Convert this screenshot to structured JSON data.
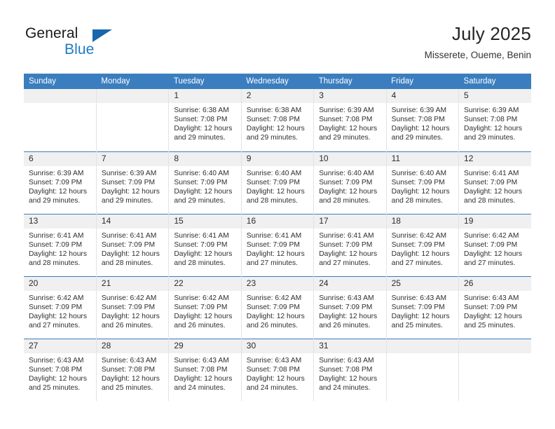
{
  "brand": {
    "name_part1": "General",
    "name_part2": "Blue",
    "logo_icon": "triangle-logo-icon"
  },
  "header": {
    "title": "July 2025",
    "subtitle": "Misserete, Oueme, Benin"
  },
  "weekday_headers": [
    "Sunday",
    "Monday",
    "Tuesday",
    "Wednesday",
    "Thursday",
    "Friday",
    "Saturday"
  ],
  "colors": {
    "header_blue": "#3b7ebf",
    "brand_blue": "#1e7bc4",
    "logo_blue": "#1767ab",
    "daynum_bg": "#f0f0f0",
    "grid_line": "#e3e3e3"
  },
  "weeks": [
    [
      {
        "day": "",
        "empty": true,
        "lines": []
      },
      {
        "day": "",
        "empty": true,
        "lines": []
      },
      {
        "day": "1",
        "empty": false,
        "lines": [
          "Sunrise: 6:38 AM",
          "Sunset: 7:08 PM",
          "Daylight: 12 hours",
          "and 29 minutes."
        ]
      },
      {
        "day": "2",
        "empty": false,
        "lines": [
          "Sunrise: 6:38 AM",
          "Sunset: 7:08 PM",
          "Daylight: 12 hours",
          "and 29 minutes."
        ]
      },
      {
        "day": "3",
        "empty": false,
        "lines": [
          "Sunrise: 6:39 AM",
          "Sunset: 7:08 PM",
          "Daylight: 12 hours",
          "and 29 minutes."
        ]
      },
      {
        "day": "4",
        "empty": false,
        "lines": [
          "Sunrise: 6:39 AM",
          "Sunset: 7:08 PM",
          "Daylight: 12 hours",
          "and 29 minutes."
        ]
      },
      {
        "day": "5",
        "empty": false,
        "lines": [
          "Sunrise: 6:39 AM",
          "Sunset: 7:08 PM",
          "Daylight: 12 hours",
          "and 29 minutes."
        ]
      }
    ],
    [
      {
        "day": "6",
        "empty": false,
        "lines": [
          "Sunrise: 6:39 AM",
          "Sunset: 7:09 PM",
          "Daylight: 12 hours",
          "and 29 minutes."
        ]
      },
      {
        "day": "7",
        "empty": false,
        "lines": [
          "Sunrise: 6:39 AM",
          "Sunset: 7:09 PM",
          "Daylight: 12 hours",
          "and 29 minutes."
        ]
      },
      {
        "day": "8",
        "empty": false,
        "lines": [
          "Sunrise: 6:40 AM",
          "Sunset: 7:09 PM",
          "Daylight: 12 hours",
          "and 29 minutes."
        ]
      },
      {
        "day": "9",
        "empty": false,
        "lines": [
          "Sunrise: 6:40 AM",
          "Sunset: 7:09 PM",
          "Daylight: 12 hours",
          "and 28 minutes."
        ]
      },
      {
        "day": "10",
        "empty": false,
        "lines": [
          "Sunrise: 6:40 AM",
          "Sunset: 7:09 PM",
          "Daylight: 12 hours",
          "and 28 minutes."
        ]
      },
      {
        "day": "11",
        "empty": false,
        "lines": [
          "Sunrise: 6:40 AM",
          "Sunset: 7:09 PM",
          "Daylight: 12 hours",
          "and 28 minutes."
        ]
      },
      {
        "day": "12",
        "empty": false,
        "lines": [
          "Sunrise: 6:41 AM",
          "Sunset: 7:09 PM",
          "Daylight: 12 hours",
          "and 28 minutes."
        ]
      }
    ],
    [
      {
        "day": "13",
        "empty": false,
        "lines": [
          "Sunrise: 6:41 AM",
          "Sunset: 7:09 PM",
          "Daylight: 12 hours",
          "and 28 minutes."
        ]
      },
      {
        "day": "14",
        "empty": false,
        "lines": [
          "Sunrise: 6:41 AM",
          "Sunset: 7:09 PM",
          "Daylight: 12 hours",
          "and 28 minutes."
        ]
      },
      {
        "day": "15",
        "empty": false,
        "lines": [
          "Sunrise: 6:41 AM",
          "Sunset: 7:09 PM",
          "Daylight: 12 hours",
          "and 28 minutes."
        ]
      },
      {
        "day": "16",
        "empty": false,
        "lines": [
          "Sunrise: 6:41 AM",
          "Sunset: 7:09 PM",
          "Daylight: 12 hours",
          "and 27 minutes."
        ]
      },
      {
        "day": "17",
        "empty": false,
        "lines": [
          "Sunrise: 6:41 AM",
          "Sunset: 7:09 PM",
          "Daylight: 12 hours",
          "and 27 minutes."
        ]
      },
      {
        "day": "18",
        "empty": false,
        "lines": [
          "Sunrise: 6:42 AM",
          "Sunset: 7:09 PM",
          "Daylight: 12 hours",
          "and 27 minutes."
        ]
      },
      {
        "day": "19",
        "empty": false,
        "lines": [
          "Sunrise: 6:42 AM",
          "Sunset: 7:09 PM",
          "Daylight: 12 hours",
          "and 27 minutes."
        ]
      }
    ],
    [
      {
        "day": "20",
        "empty": false,
        "lines": [
          "Sunrise: 6:42 AM",
          "Sunset: 7:09 PM",
          "Daylight: 12 hours",
          "and 27 minutes."
        ]
      },
      {
        "day": "21",
        "empty": false,
        "lines": [
          "Sunrise: 6:42 AM",
          "Sunset: 7:09 PM",
          "Daylight: 12 hours",
          "and 26 minutes."
        ]
      },
      {
        "day": "22",
        "empty": false,
        "lines": [
          "Sunrise: 6:42 AM",
          "Sunset: 7:09 PM",
          "Daylight: 12 hours",
          "and 26 minutes."
        ]
      },
      {
        "day": "23",
        "empty": false,
        "lines": [
          "Sunrise: 6:42 AM",
          "Sunset: 7:09 PM",
          "Daylight: 12 hours",
          "and 26 minutes."
        ]
      },
      {
        "day": "24",
        "empty": false,
        "lines": [
          "Sunrise: 6:43 AM",
          "Sunset: 7:09 PM",
          "Daylight: 12 hours",
          "and 26 minutes."
        ]
      },
      {
        "day": "25",
        "empty": false,
        "lines": [
          "Sunrise: 6:43 AM",
          "Sunset: 7:09 PM",
          "Daylight: 12 hours",
          "and 25 minutes."
        ]
      },
      {
        "day": "26",
        "empty": false,
        "lines": [
          "Sunrise: 6:43 AM",
          "Sunset: 7:09 PM",
          "Daylight: 12 hours",
          "and 25 minutes."
        ]
      }
    ],
    [
      {
        "day": "27",
        "empty": false,
        "lines": [
          "Sunrise: 6:43 AM",
          "Sunset: 7:08 PM",
          "Daylight: 12 hours",
          "and 25 minutes."
        ]
      },
      {
        "day": "28",
        "empty": false,
        "lines": [
          "Sunrise: 6:43 AM",
          "Sunset: 7:08 PM",
          "Daylight: 12 hours",
          "and 25 minutes."
        ]
      },
      {
        "day": "29",
        "empty": false,
        "lines": [
          "Sunrise: 6:43 AM",
          "Sunset: 7:08 PM",
          "Daylight: 12 hours",
          "and 24 minutes."
        ]
      },
      {
        "day": "30",
        "empty": false,
        "lines": [
          "Sunrise: 6:43 AM",
          "Sunset: 7:08 PM",
          "Daylight: 12 hours",
          "and 24 minutes."
        ]
      },
      {
        "day": "31",
        "empty": false,
        "lines": [
          "Sunrise: 6:43 AM",
          "Sunset: 7:08 PM",
          "Daylight: 12 hours",
          "and 24 minutes."
        ]
      },
      {
        "day": "",
        "empty": true,
        "lines": []
      },
      {
        "day": "",
        "empty": true,
        "lines": []
      }
    ]
  ]
}
